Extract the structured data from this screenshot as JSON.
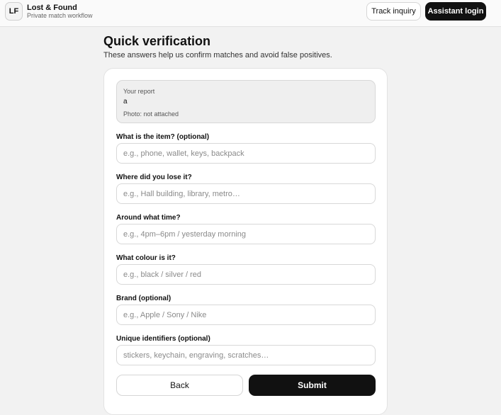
{
  "header": {
    "logo_text": "LF",
    "title": "Lost & Found",
    "subtitle": "Private match workflow",
    "track_label": "Track inquiry",
    "login_label": "Assistant login"
  },
  "page": {
    "title": "Quick verification",
    "subtitle": "These answers help us confirm matches and avoid false positives."
  },
  "report": {
    "label": "Your report",
    "value": "a",
    "photo_status": "Photo: not attached"
  },
  "fields": [
    {
      "label": "What is the item? (optional)",
      "placeholder": "e.g., phone, wallet, keys, backpack",
      "value": ""
    },
    {
      "label": "Where did you lose it?",
      "placeholder": "e.g., Hall building, library, metro…",
      "value": ""
    },
    {
      "label": "Around what time?",
      "placeholder": "e.g., 4pm–6pm / yesterday morning",
      "value": ""
    },
    {
      "label": "What colour is it?",
      "placeholder": "e.g., black / silver / red",
      "value": ""
    },
    {
      "label": "Brand (optional)",
      "placeholder": "e.g., Apple / Sony / Nike",
      "value": ""
    },
    {
      "label": "Unique identifiers (optional)",
      "placeholder": "stickers, keychain, engraving, scratches…",
      "value": ""
    }
  ],
  "actions": {
    "back_label": "Back",
    "submit_label": "Submit"
  }
}
